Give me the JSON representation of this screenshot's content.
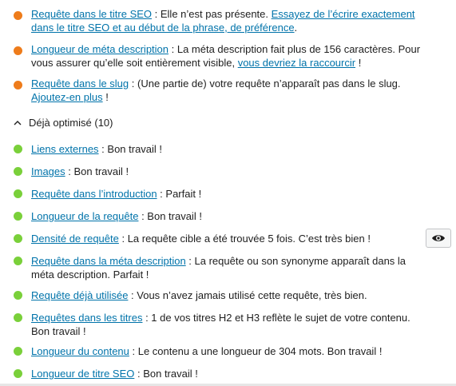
{
  "problems": [
    {
      "link": "Requête dans le titre SEO",
      "text": " : Elle n’est pas présente. ",
      "link2": "Essayez de l’écrire exactement dans le titre SEO et au début de la phrase, de préférence",
      "text2": "."
    },
    {
      "link": "Longueur de méta description",
      "text": " : La méta description fait plus de 156 caractères. Pour vous assurer qu’elle soit entièrement visible, ",
      "link2": "vous devriez la raccourcir",
      "text2": " !"
    },
    {
      "link": "Requête dans le slug",
      "text": " : (Une partie de) votre requête n’apparaît pas dans le slug. ",
      "link2": "Ajoutez-en plus",
      "text2": " !"
    }
  ],
  "good_section": {
    "label": "Déjà optimisé (10)"
  },
  "good": [
    {
      "link": "Liens externes",
      "text": " : Bon travail !"
    },
    {
      "link": "Images",
      "text": " : Bon travail !"
    },
    {
      "link": "Requête dans l’introduction",
      "text": " : Parfait !"
    },
    {
      "link": "Longueur de la requête",
      "text": " : Bon travail !"
    },
    {
      "link": "Densité de requête",
      "text": " : La requête cible a été trouvée 5 fois. C’est très bien !"
    },
    {
      "link": "Requête dans la méta description",
      "text": " : La requête ou son synonyme apparaît dans la méta description. Parfait !"
    },
    {
      "link": "Requête déjà utilisée",
      "text": " : Vous n’avez jamais utilisé cette requête, très bien."
    },
    {
      "link": "Requêtes dans les titres",
      "text": " : 1 de vos titres H2 et H3 reflète le sujet de votre contenu. Bon travail !"
    },
    {
      "link": "Longueur du contenu",
      "text": " : Le contenu a une longueur de 304 mots. Bon travail !"
    },
    {
      "link": "Longueur de titre SEO",
      "text": " : Bon travail !"
    }
  ],
  "colors": {
    "problem": "#ee7c1b",
    "good": "#7ad03a",
    "link": "#0073aa"
  },
  "icons": {
    "section_toggle": "chevron-up-icon",
    "eye": "eye-icon"
  }
}
